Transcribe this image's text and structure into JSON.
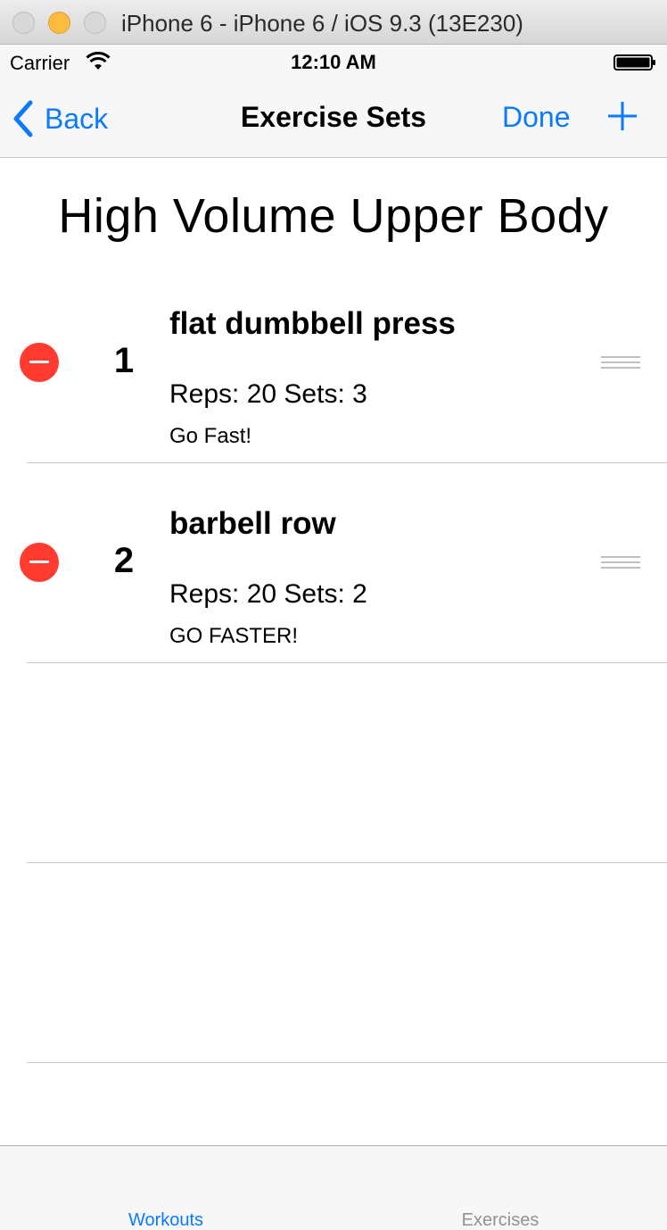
{
  "window": {
    "title": "iPhone 6 - iPhone 6 / iOS 9.3 (13E230)"
  },
  "status_bar": {
    "carrier": "Carrier",
    "time": "12:10 AM"
  },
  "nav": {
    "back_label": "Back",
    "title": "Exercise Sets",
    "done_label": "Done"
  },
  "workout": {
    "title": "High Volume Upper Body"
  },
  "exercises": [
    {
      "number": "1",
      "name": "flat dumbbell press",
      "reps_sets": "Reps: 20 Sets: 3",
      "note": "Go Fast!"
    },
    {
      "number": "2",
      "name": "barbell row",
      "reps_sets": "Reps: 20 Sets: 2",
      "note": "GO FASTER!"
    }
  ],
  "tabs": [
    {
      "label": "Workouts",
      "selected": true
    },
    {
      "label": "Exercises",
      "selected": false
    }
  ],
  "colors": {
    "accent": "#0a7aff",
    "delete": "#ff3b30",
    "tab_inactive": "#929292"
  }
}
